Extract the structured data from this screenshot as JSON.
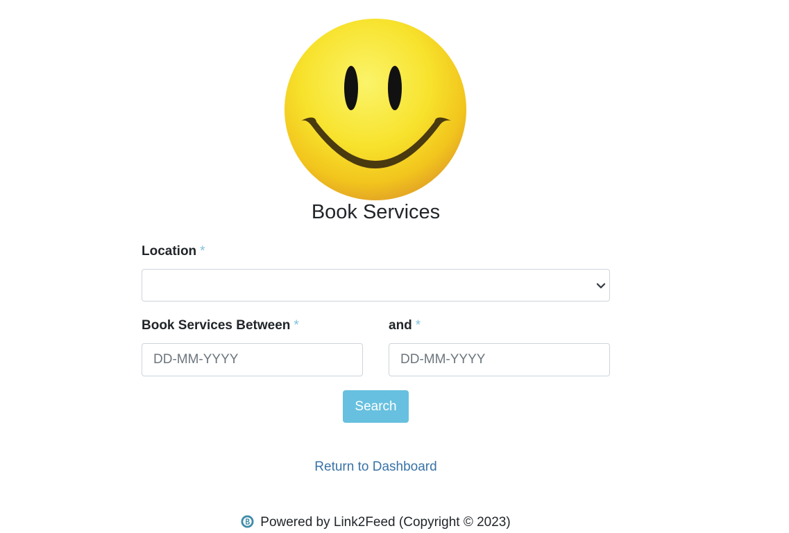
{
  "page": {
    "title": "Book Services"
  },
  "form": {
    "location_label": "Location",
    "location_required": "*",
    "location_value": "",
    "between_label": "Book Services Between",
    "between_required": "*",
    "between_placeholder": "DD-MM-YYYY",
    "and_label": "and",
    "and_required": "*",
    "and_placeholder": "DD-MM-YYYY",
    "search_label": "Search"
  },
  "nav": {
    "return_label": "Return to Dashboard"
  },
  "footer": {
    "text": "Powered by Link2Feed (Copyright © 2023)",
    "badge_icon": "link2feed-logo-icon"
  },
  "colors": {
    "button": "#67c0df",
    "link": "#3872a6",
    "required": "#7ec1dc"
  },
  "logo": {
    "icon": "smiley-face-icon"
  }
}
